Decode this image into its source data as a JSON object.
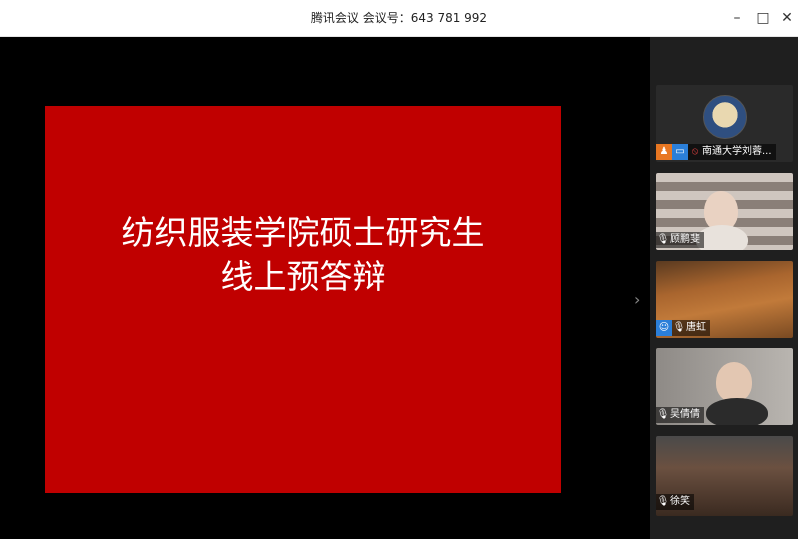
{
  "window": {
    "title": "腾讯会议 会议号：643 781 992",
    "minimize_glyph": "–",
    "maximize_glyph": "□",
    "close_glyph": "✕"
  },
  "slide": {
    "line1": "纺织服装学院硕士研究生",
    "line2": "线上预答辩"
  },
  "sidebar": {
    "collapse_glyph": "›",
    "participants": [
      {
        "name": "南通大学刘蓉...",
        "mic": "muted",
        "is_host": true,
        "sharing": true
      },
      {
        "name": "顾鹏斐",
        "mic": "on"
      },
      {
        "name": "唐虹",
        "mic": "on",
        "avatar_badge": true
      },
      {
        "name": "吴倩倩",
        "mic": "on"
      },
      {
        "name": "徐笑",
        "mic": "on"
      }
    ]
  },
  "colors": {
    "slide_bg": "#c00000",
    "stage_bg": "#000000",
    "sidebar_bg": "#1f1f1f",
    "host_badge": "#e87722",
    "share_badge": "#2b7fd9"
  }
}
